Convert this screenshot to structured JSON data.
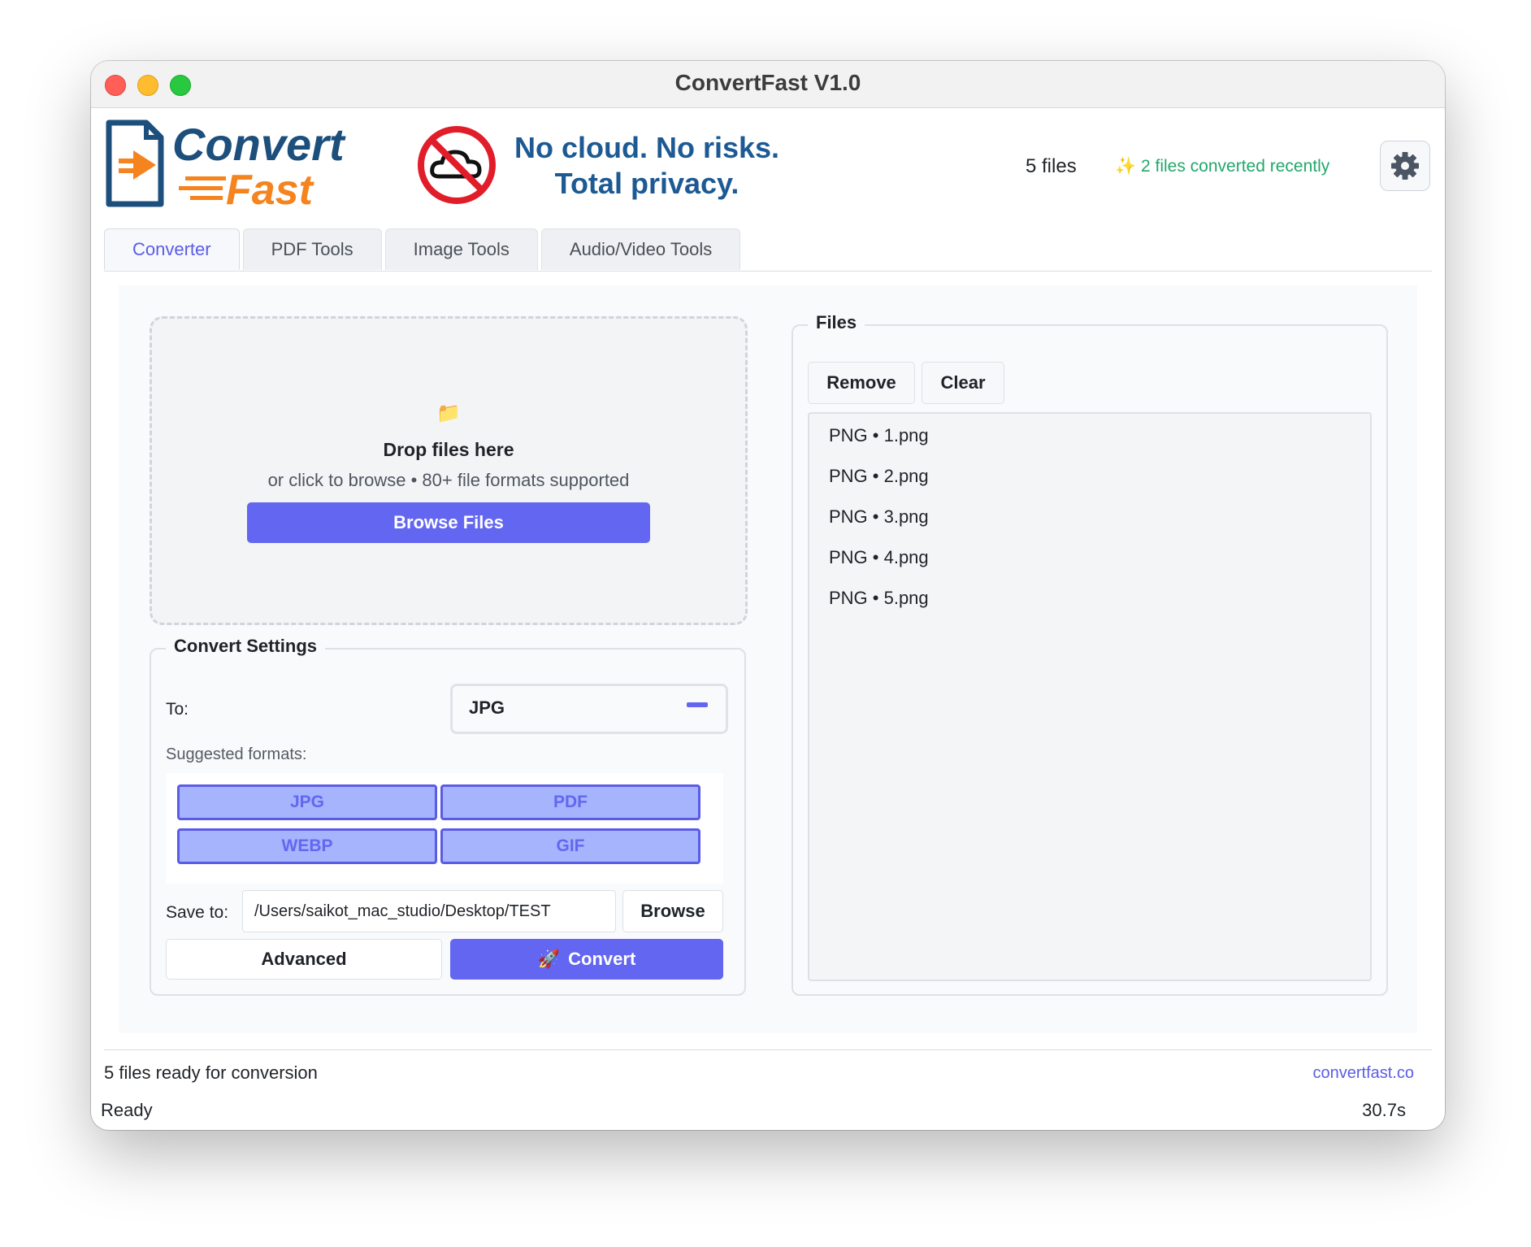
{
  "window": {
    "title": "ConvertFast V1.0"
  },
  "header": {
    "logo_text_1": "Convert",
    "logo_text_2": "Fast",
    "tagline_line1": "No cloud. No risks.",
    "tagline_line2": "Total privacy.",
    "file_count": "5 files",
    "recent": "✨ 2 files converted recently",
    "settings_icon": "gear-icon"
  },
  "tabs": [
    {
      "label": "Converter",
      "active": true
    },
    {
      "label": "PDF Tools",
      "active": false
    },
    {
      "label": "Image Tools",
      "active": false
    },
    {
      "label": "Audio/Video Tools",
      "active": false
    }
  ],
  "dropzone": {
    "icon": "📁",
    "title": "Drop files here",
    "subtitle": "or click to browse • 80+ file formats supported",
    "button": "Browse Files"
  },
  "settings": {
    "group_label": "Convert Settings",
    "to_label": "To:",
    "to_value": "JPG",
    "suggested_label": "Suggested formats:",
    "formats": [
      "JPG",
      "PDF",
      "WEBP",
      "GIF"
    ],
    "save_label": "Save to:",
    "save_path": "/Users/saikot_mac_studio/Desktop/TEST",
    "browse_button": "Browse",
    "advanced_button": "Advanced",
    "convert_icon": "🚀",
    "convert_button": "Convert"
  },
  "files": {
    "group_label": "Files",
    "remove_button": "Remove",
    "clear_button": "Clear",
    "items": [
      "PNG • 1.png",
      "PNG • 2.png",
      "PNG • 3.png",
      "PNG • 4.png",
      "PNG • 5.png"
    ]
  },
  "footer": {
    "message": "5 files ready for conversion",
    "link": "convertfast.co",
    "status": "Ready",
    "time": "30.7s"
  },
  "colors": {
    "accent": "#6366f1",
    "tagline": "#1d5a94",
    "recent": "#22a86b",
    "logo_orange": "#f5841f",
    "logo_navy": "#1d4f7c"
  }
}
